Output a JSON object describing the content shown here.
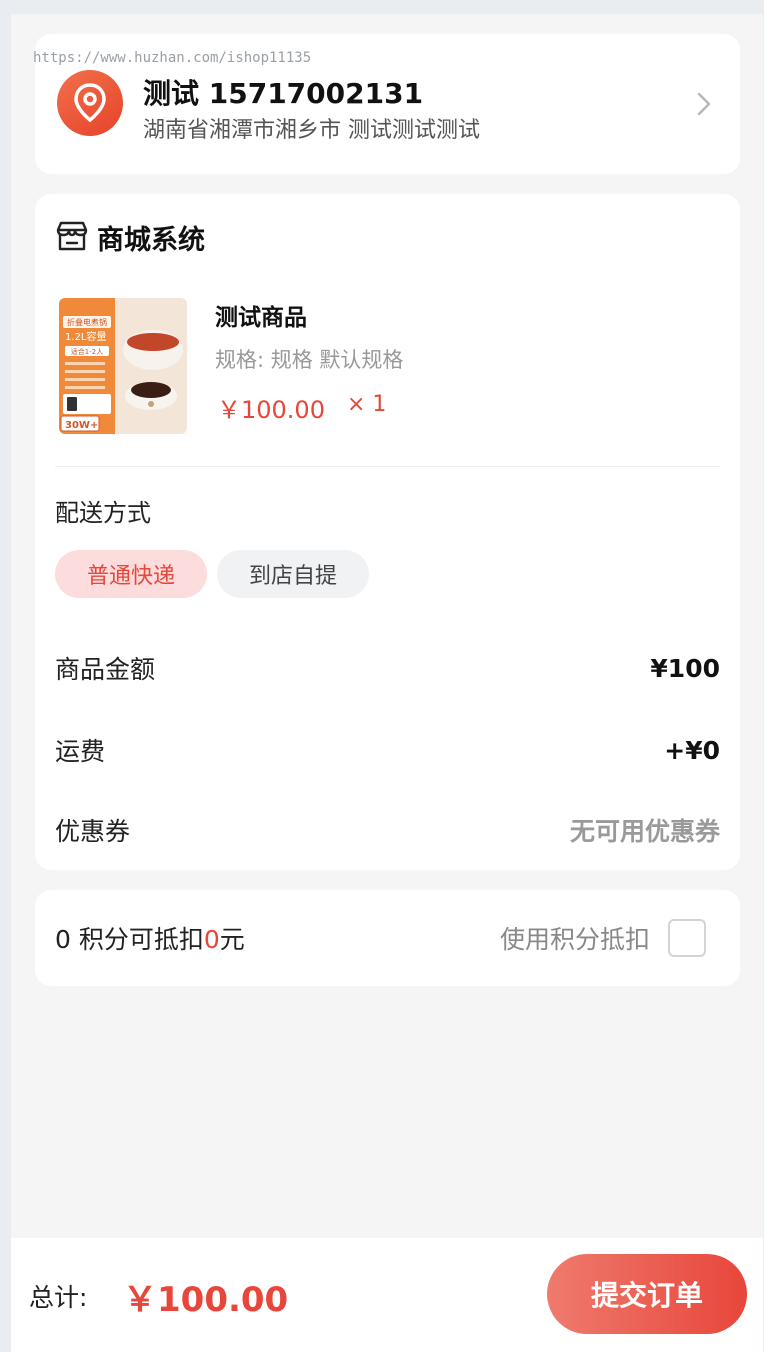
{
  "watermark": "https://www.huzhan.com/ishop11135",
  "address": {
    "name_phone": "测试 15717002131",
    "detail": "湖南省湘潭市湘乡市 测试测试测试",
    "icon": "location-pin-icon"
  },
  "shop": {
    "name": "商城系统",
    "icon": "store-icon"
  },
  "product": {
    "name": "测试商品",
    "spec": "规格: 规格 默认规格",
    "price": "￥100.00",
    "qty": "× 1",
    "image_lines": [
      "折叠电煮锅",
      "1.2L容量",
      "适合1-2人",
      "30W+"
    ]
  },
  "shipping": {
    "title": "配送方式",
    "options": [
      "普通快递",
      "到店自提"
    ],
    "selected": "普通快递"
  },
  "summary": [
    {
      "label": "商品金额",
      "value": "¥100"
    },
    {
      "label": "运费",
      "value": "+¥0"
    },
    {
      "label": "优惠券",
      "value": "无可用优惠券"
    }
  ],
  "points": {
    "prefix": "0 积分可抵扣",
    "amount": "0",
    "suffix": "元",
    "use_label": "使用积分抵扣",
    "checked": false
  },
  "footer": {
    "total_label": "总计:",
    "total_value": "￥100.00",
    "submit_label": "提交订单"
  },
  "colors": {
    "accent": "#e8463a",
    "chip_active_bg": "#fcdcdc"
  }
}
